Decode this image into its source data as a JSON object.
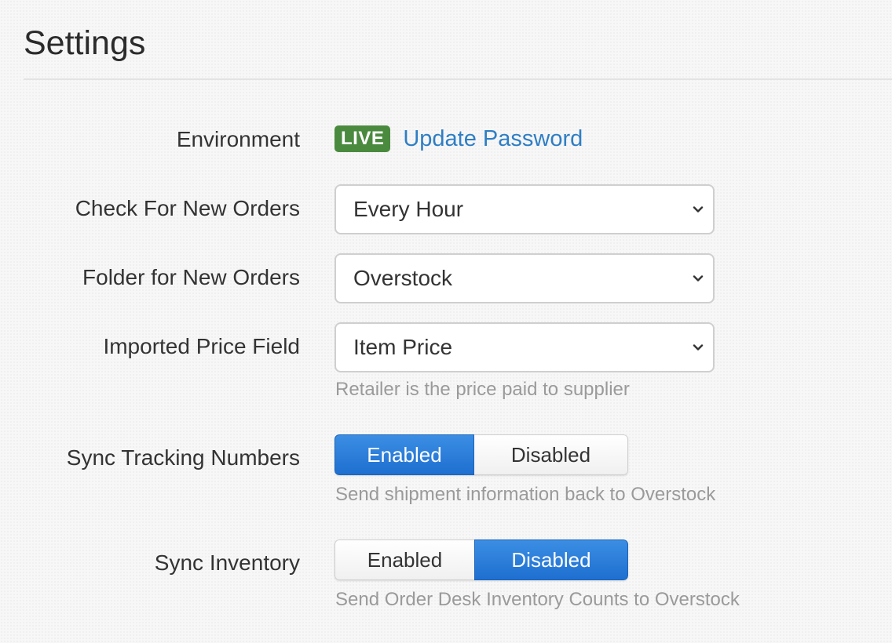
{
  "page": {
    "title": "Settings"
  },
  "environment": {
    "label": "Environment",
    "badge": "LIVE",
    "link": "Update Password"
  },
  "check_orders": {
    "label": "Check For New Orders",
    "value": "Every Hour"
  },
  "folder_orders": {
    "label": "Folder for New Orders",
    "value": "Overstock"
  },
  "price_field": {
    "label": "Imported Price Field",
    "value": "Item Price",
    "help": "Retailer is the price paid to supplier"
  },
  "sync_tracking": {
    "label": "Sync Tracking Numbers",
    "enabled_label": "Enabled",
    "disabled_label": "Disabled",
    "selected": "Enabled",
    "help": "Send shipment information back to Overstock"
  },
  "sync_inventory": {
    "label": "Sync Inventory",
    "enabled_label": "Enabled",
    "disabled_label": "Disabled",
    "selected": "Disabled",
    "help": "Send Order Desk Inventory Counts to Overstock"
  },
  "colors": {
    "accent": "#1e6fd0",
    "live": "#4a8a3f",
    "link": "#2e7ec4"
  }
}
